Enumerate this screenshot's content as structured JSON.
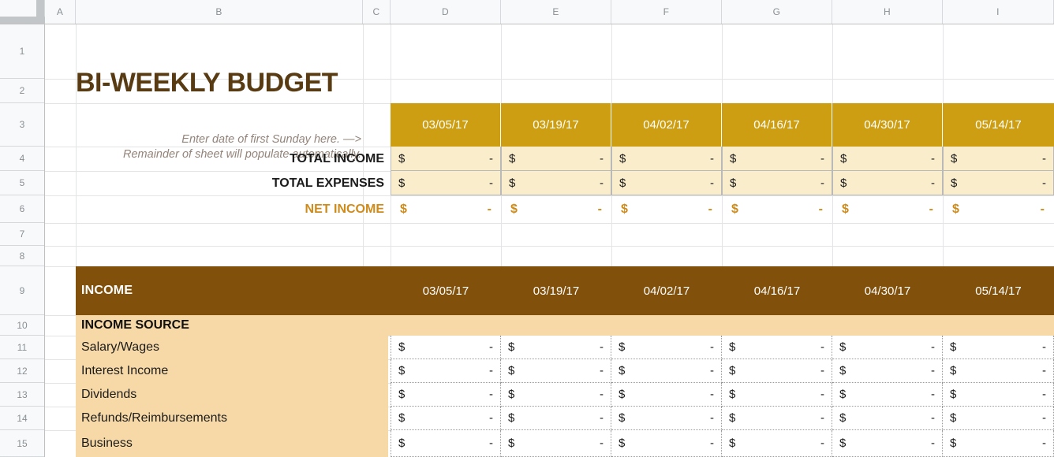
{
  "spreadsheet": {
    "column_headers": [
      "A",
      "B",
      "C",
      "D",
      "E",
      "F",
      "G",
      "H",
      "I"
    ],
    "row_headers": [
      "1",
      "2",
      "3",
      "4",
      "5",
      "6",
      "7",
      "8",
      "9",
      "10",
      "11",
      "12",
      "13",
      "14",
      "15"
    ],
    "select_all_name": "select-all-corner"
  },
  "colors": {
    "gold": "#CE9E12",
    "brown": "#81510B",
    "peach": "#F7D9A8",
    "cream": "#FAEDCC",
    "title_brown": "#583B13",
    "net_gold": "#CF8B1A"
  },
  "title": "BI-WEEKLY BUDGET",
  "instructions": {
    "line1": "Enter date of first Sunday here. —>",
    "line2": "Remainder of sheet will populate automatically."
  },
  "summary": {
    "dates": [
      "03/05/17",
      "03/19/17",
      "04/02/17",
      "04/16/17",
      "04/30/17",
      "05/14/17"
    ],
    "rows": [
      {
        "label": "TOTAL INCOME",
        "style": "cream",
        "values": [
          {
            "currency": "$",
            "amount": "-"
          },
          {
            "currency": "$",
            "amount": "-"
          },
          {
            "currency": "$",
            "amount": "-"
          },
          {
            "currency": "$",
            "amount": "-"
          },
          {
            "currency": "$",
            "amount": "-"
          },
          {
            "currency": "$",
            "amount": "-"
          }
        ]
      },
      {
        "label": "TOTAL EXPENSES",
        "style": "cream",
        "values": [
          {
            "currency": "$",
            "amount": "-"
          },
          {
            "currency": "$",
            "amount": "-"
          },
          {
            "currency": "$",
            "amount": "-"
          },
          {
            "currency": "$",
            "amount": "-"
          },
          {
            "currency": "$",
            "amount": "-"
          },
          {
            "currency": "$",
            "amount": "-"
          }
        ]
      },
      {
        "label": "NET INCOME",
        "style": "net",
        "values": [
          {
            "currency": "$",
            "amount": "-"
          },
          {
            "currency": "$",
            "amount": "-"
          },
          {
            "currency": "$",
            "amount": "-"
          },
          {
            "currency": "$",
            "amount": "-"
          },
          {
            "currency": "$",
            "amount": "-"
          },
          {
            "currency": "$",
            "amount": "-"
          }
        ]
      }
    ]
  },
  "income_section": {
    "heading": "INCOME",
    "dates": [
      "03/05/17",
      "03/19/17",
      "04/02/17",
      "04/16/17",
      "04/30/17",
      "05/14/17"
    ],
    "source_column_header": "INCOME SOURCE",
    "rows": [
      {
        "label": "Salary/Wages",
        "values": [
          {
            "currency": "$",
            "amount": "-"
          },
          {
            "currency": "$",
            "amount": "-"
          },
          {
            "currency": "$",
            "amount": "-"
          },
          {
            "currency": "$",
            "amount": "-"
          },
          {
            "currency": "$",
            "amount": "-"
          },
          {
            "currency": "$",
            "amount": "-"
          }
        ]
      },
      {
        "label": "Interest Income",
        "values": [
          {
            "currency": "$",
            "amount": "-"
          },
          {
            "currency": "$",
            "amount": "-"
          },
          {
            "currency": "$",
            "amount": "-"
          },
          {
            "currency": "$",
            "amount": "-"
          },
          {
            "currency": "$",
            "amount": "-"
          },
          {
            "currency": "$",
            "amount": "-"
          }
        ]
      },
      {
        "label": "Dividends",
        "values": [
          {
            "currency": "$",
            "amount": "-"
          },
          {
            "currency": "$",
            "amount": "-"
          },
          {
            "currency": "$",
            "amount": "-"
          },
          {
            "currency": "$",
            "amount": "-"
          },
          {
            "currency": "$",
            "amount": "-"
          },
          {
            "currency": "$",
            "amount": "-"
          }
        ]
      },
      {
        "label": "Refunds/Reimbursements",
        "values": [
          {
            "currency": "$",
            "amount": "-"
          },
          {
            "currency": "$",
            "amount": "-"
          },
          {
            "currency": "$",
            "amount": "-"
          },
          {
            "currency": "$",
            "amount": "-"
          },
          {
            "currency": "$",
            "amount": "-"
          },
          {
            "currency": "$",
            "amount": "-"
          }
        ]
      },
      {
        "label": "Business",
        "values": [
          {
            "currency": "$",
            "amount": "-"
          },
          {
            "currency": "$",
            "amount": "-"
          },
          {
            "currency": "$",
            "amount": "-"
          },
          {
            "currency": "$",
            "amount": "-"
          },
          {
            "currency": "$",
            "amount": "-"
          },
          {
            "currency": "$",
            "amount": "-"
          }
        ]
      }
    ]
  }
}
